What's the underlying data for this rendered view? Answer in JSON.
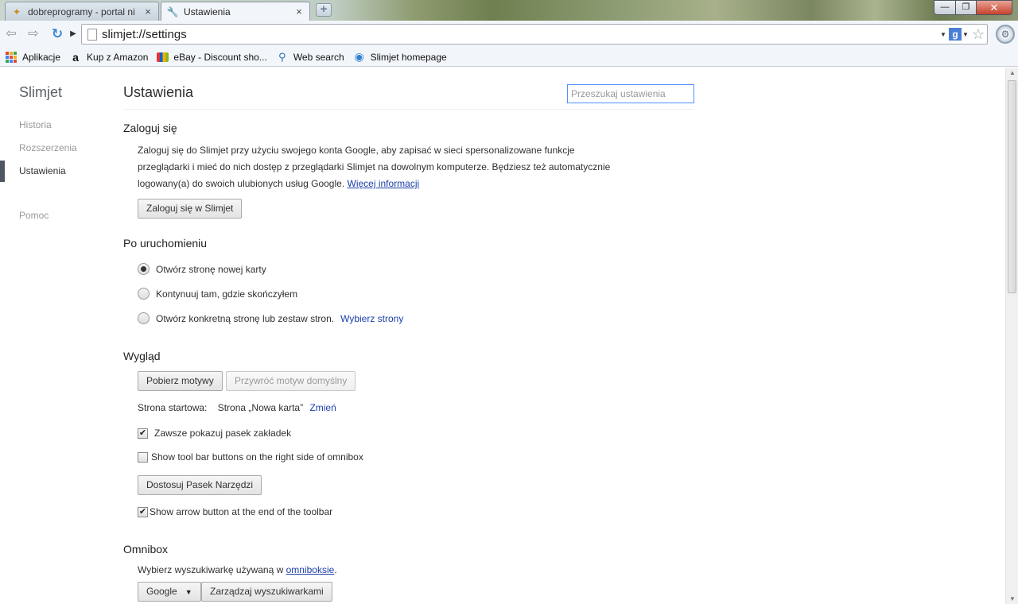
{
  "tabs": [
    {
      "title": "dobreprogramy - portal ni",
      "icon": "dobreprogramy-icon",
      "active": false
    },
    {
      "title": "Ustawienia",
      "icon": "wrench-icon",
      "active": true
    }
  ],
  "window": {
    "minimize_icon": "minimize-icon",
    "maximize_icon": "restore-icon",
    "close_icon": "close-icon"
  },
  "toolbar": {
    "url": "slimjet://settings",
    "back_icon": "back-arrow-icon",
    "forward_icon": "forward-arrow-icon",
    "reload_icon": "reload-icon"
  },
  "bookmarks": [
    {
      "label": "Aplikacje",
      "icon": "apps-grid-icon"
    },
    {
      "label": "Kup z Amazon",
      "icon": "amazon-icon"
    },
    {
      "label": "eBay - Discount sho...",
      "icon": "ebay-icon"
    },
    {
      "label": "Web search",
      "icon": "search-icon"
    },
    {
      "label": "Slimjet homepage",
      "icon": "globe-icon"
    }
  ],
  "sidebar": {
    "title": "Slimjet",
    "items": [
      {
        "label": "Historia"
      },
      {
        "label": "Rozszerzenia"
      },
      {
        "label": "Ustawienia"
      },
      {
        "label": "Pomoc"
      }
    ],
    "active_index": 2
  },
  "header": {
    "title": "Ustawienia",
    "search_placeholder": "Przeszukaj ustawienia"
  },
  "signin": {
    "title": "Zaloguj się",
    "line1": "Zaloguj się do Slimjet przy użyciu swojego konta Google, aby zapisać w sieci spersonalizowane funkcje",
    "line2": "przeglądarki i mieć do nich dostęp z przeglądarki Slimjet na dowolnym komputerze. Będziesz też automatycznie",
    "line3": "logowany(a) do swoich ulubionych usług Google.",
    "more_link": "Więcej informacji",
    "button": "Zaloguj się w Slimjet"
  },
  "startup": {
    "title": "Po uruchomieniu",
    "options": [
      {
        "label": "Otwórz stronę nowej karty",
        "checked": true
      },
      {
        "label": "Kontynuuj tam, gdzie skończyłem",
        "checked": false
      },
      {
        "label": "Otwórz konkretną stronę lub zestaw stron.",
        "checked": false
      }
    ],
    "set_pages_link": "Wybierz strony"
  },
  "appearance": {
    "title": "Wygląd",
    "get_themes_button": "Pobierz motywy",
    "reset_theme_button": "Przywróć motyw domyślny",
    "homepage_label": "Strona startowa:",
    "homepage_value": "Strona „Nowa karta”",
    "homepage_change_link": "Zmień",
    "show_bookmarks_bar": {
      "label": "Zawsze pokazuj pasek zakładek",
      "checked": true
    },
    "toolbar_right": {
      "label": "Show tool bar buttons on the right side of omnibox",
      "checked": false
    },
    "customize_toolbar_button": "Dostosuj Pasek Narzędzi",
    "arrow_button": {
      "label": "Show arrow button at the end of the toolbar",
      "checked": true
    }
  },
  "omnibox": {
    "title": "Omnibox",
    "text": "Wybierz wyszukiwarkę używaną w",
    "link": "omniboksie",
    "period": ".",
    "engine": "Google",
    "manage_button": "Zarządzaj wyszukiwarkami"
  },
  "colors": {
    "accent": "#4d90fe",
    "link": "#1a3fa8"
  }
}
